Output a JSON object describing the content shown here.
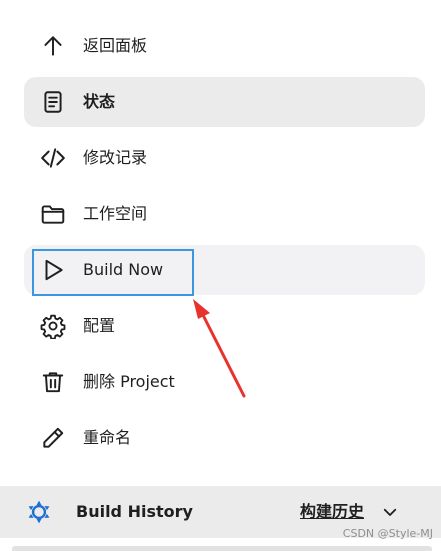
{
  "nav": {
    "items": [
      {
        "label": "返回面板",
        "icon": "arrow-up-icon"
      },
      {
        "label": "状态",
        "icon": "document-icon",
        "active": true
      },
      {
        "label": "修改记录",
        "icon": "code-icon"
      },
      {
        "label": "工作空间",
        "icon": "folder-icon"
      },
      {
        "label": "Build Now",
        "icon": "play-icon"
      },
      {
        "label": "配置",
        "icon": "gear-icon"
      },
      {
        "label": "删除 Project",
        "icon": "trash-icon"
      },
      {
        "label": "重命名",
        "icon": "pencil-icon"
      }
    ]
  },
  "build_history": {
    "title": "Build History",
    "link": "构建历史"
  },
  "annotation": {
    "highlight_color": "#3b97e0",
    "arrow_color": "#e8322d"
  },
  "watermark": "CSDN @Style-MJ"
}
